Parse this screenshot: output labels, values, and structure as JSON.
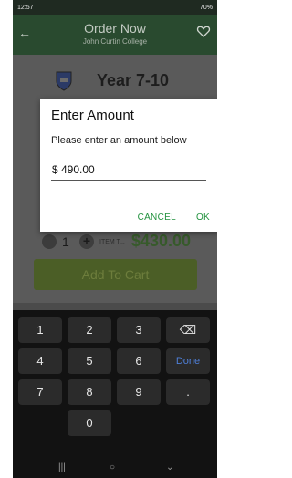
{
  "status_bar": {
    "time": "12:57",
    "right": "70%"
  },
  "header": {
    "title": "Order Now",
    "subtitle": "John Curtin College"
  },
  "page": {
    "year_label": "Year 7-10",
    "quantity": "1",
    "plus_symbol": "+",
    "item_text": "ITEM T...",
    "price": "$430.00",
    "add_to_cart_label": "Add To Cart"
  },
  "dialog": {
    "title": "Enter Amount",
    "message": "Please enter an amount below",
    "amount_value": "$ 490.00",
    "cancel_label": "CANCEL",
    "ok_label": "OK"
  },
  "keyboard": {
    "keys": [
      "1",
      "2",
      "3",
      "⌫",
      "4",
      "5",
      "6",
      "Done",
      "7",
      "8",
      "9",
      ".",
      "0"
    ]
  },
  "nav": {
    "recents": "|||",
    "home": "○",
    "back": "⌄"
  },
  "colors": {
    "accent_green": "#22923e",
    "header_green": "#294a2f"
  }
}
